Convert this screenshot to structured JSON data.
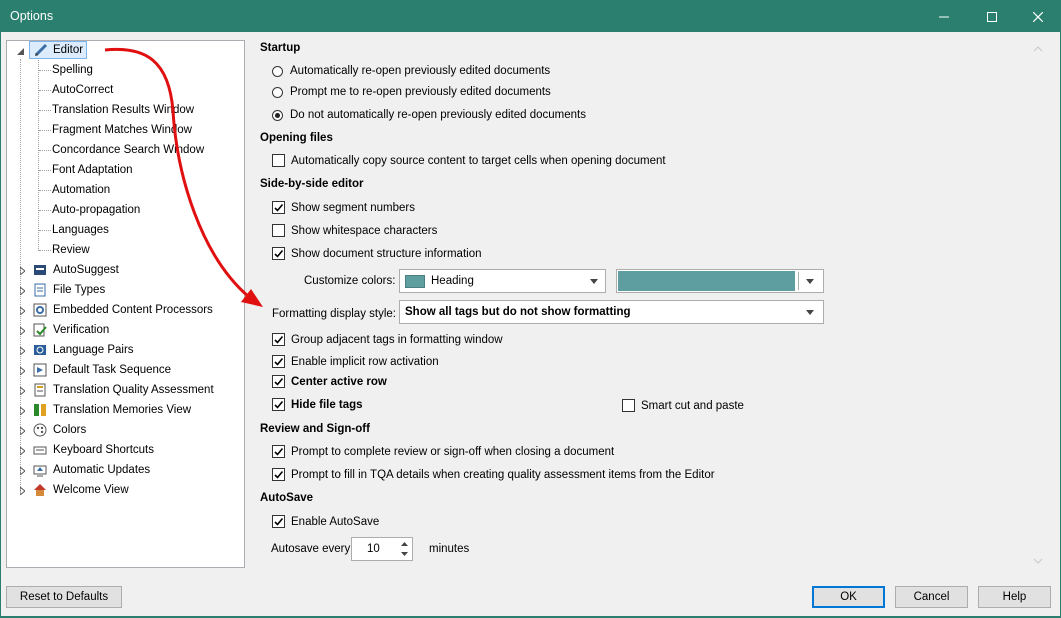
{
  "window": {
    "title": "Options"
  },
  "tree": {
    "editor": {
      "label": "Editor",
      "children": [
        "Spelling",
        "AutoCorrect",
        "Translation Results Window",
        "Fragment Matches Window",
        "Concordance Search Window",
        "Font Adaptation",
        "Automation",
        "Auto-propagation",
        "Languages",
        "Review"
      ]
    },
    "groups": [
      {
        "label": "AutoSuggest",
        "icon": "autosuggest-icon"
      },
      {
        "label": "File Types",
        "icon": "file-types-icon"
      },
      {
        "label": "Embedded Content Processors",
        "icon": "gear-icon"
      },
      {
        "label": "Verification",
        "icon": "verification-icon"
      },
      {
        "label": "Language Pairs",
        "icon": "language-pairs-icon"
      },
      {
        "label": "Default Task Sequence",
        "icon": "task-sequence-icon"
      },
      {
        "label": "Translation Quality Assessment",
        "icon": "tqa-icon"
      },
      {
        "label": "Translation Memories View",
        "icon": "tm-view-icon"
      },
      {
        "label": "Colors",
        "icon": "palette-icon"
      },
      {
        "label": "Keyboard Shortcuts",
        "icon": "keyboard-icon"
      },
      {
        "label": "Automatic Updates",
        "icon": "updates-icon"
      },
      {
        "label": "Welcome View",
        "icon": "home-icon"
      }
    ]
  },
  "startup": {
    "heading": "Startup",
    "options": [
      {
        "label": "Automatically re-open previously edited documents",
        "selected": false
      },
      {
        "label": "Prompt me to re-open previously edited documents",
        "selected": false
      },
      {
        "label": "Do not automatically re-open previously edited documents",
        "selected": true
      }
    ]
  },
  "opening_files": {
    "heading": "Opening files",
    "copy_source": {
      "label": "Automatically copy source content to target cells when opening document",
      "checked": false
    }
  },
  "side_by_side": {
    "heading": "Side-by-side editor",
    "show_segment_numbers": {
      "label": "Show segment numbers",
      "checked": true
    },
    "show_whitespace": {
      "label": "Show whitespace characters",
      "checked": false
    },
    "show_structure": {
      "label": "Show document structure information",
      "checked": true
    },
    "customize_colors_label": "Customize colors:",
    "color_item": "Heading",
    "color_value": "#5f9ea0",
    "formatting_label": "Formatting display style:",
    "formatting_value": "Show all tags but do not show formatting",
    "group_tags": {
      "label": "Group adjacent tags in formatting window",
      "checked": true
    },
    "implicit_row": {
      "label": "Enable implicit row activation",
      "checked": true
    },
    "center_row": {
      "label": "Center active row",
      "checked": true
    },
    "hide_file_tags": {
      "label": "Hide file tags",
      "checked": true
    },
    "smart_cut": {
      "label": "Smart cut and paste",
      "checked": false
    }
  },
  "review": {
    "heading": "Review and Sign-off",
    "prompt_complete": {
      "label": "Prompt to complete review or sign-off when closing a document",
      "checked": true
    },
    "prompt_tqa": {
      "label": "Prompt to fill in TQA details when creating quality assessment items from the Editor",
      "checked": true
    }
  },
  "autosave": {
    "heading": "AutoSave",
    "enable": {
      "label": "Enable AutoSave",
      "checked": true
    },
    "every_label": "Autosave every",
    "value": "10",
    "unit": "minutes"
  },
  "buttons": {
    "reset": "Reset to Defaults",
    "ok": "OK",
    "cancel": "Cancel",
    "help": "Help"
  },
  "colors": {
    "titlebar": "#2a7f6f",
    "accent": "#0078d7",
    "annotation_arrow": "#e01010"
  }
}
